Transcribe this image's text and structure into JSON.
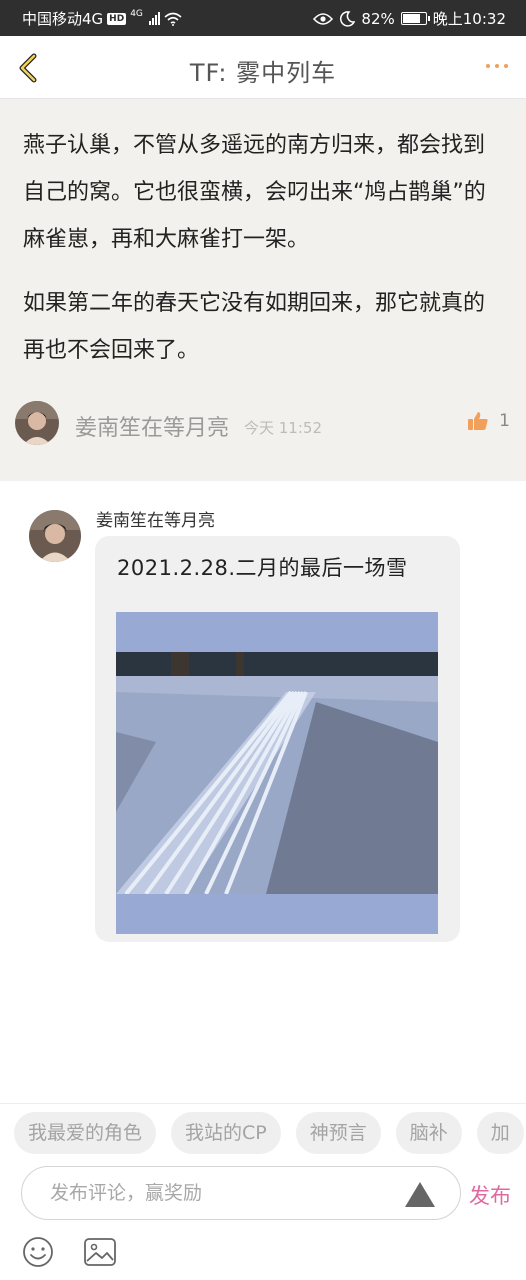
{
  "status": {
    "carrier": "中国移动4G",
    "hd": "HD",
    "net": "4G",
    "battery": "82%",
    "battery_level": 0.82,
    "time": "晚上10:32"
  },
  "header": {
    "title": "TF: 雾中列车",
    "back_icon": "chevron-left-icon",
    "more_icon": "more-dots-icon",
    "accent": "#f0a05a"
  },
  "quote": {
    "paragraph1": "燕子认巢，不管从多遥远的南方归来，都会找到自己的窝。它也很蛮横，会叼出来“鸠占鹊巢”的麻雀崽，再和大麻雀打一架。",
    "paragraph2": "如果第二年的春天它没有如期回来，那它就真的再也不会回来了。",
    "author": "姜南笙在等月亮",
    "time": "今天 11:52",
    "likes": "1"
  },
  "message": {
    "author": "姜南笙在等月亮",
    "text": "2021.2.28.二月的最后一场雪"
  },
  "tags": [
    "我最爱的角色",
    "我站的CP",
    "神预言",
    "脑补",
    "加"
  ],
  "composer": {
    "placeholder": "发布评论，赢奖励",
    "publish_label": "发布",
    "publish_color": "#e06aa0",
    "emoji_icon": "emoji-icon",
    "image_icon": "image-icon"
  }
}
